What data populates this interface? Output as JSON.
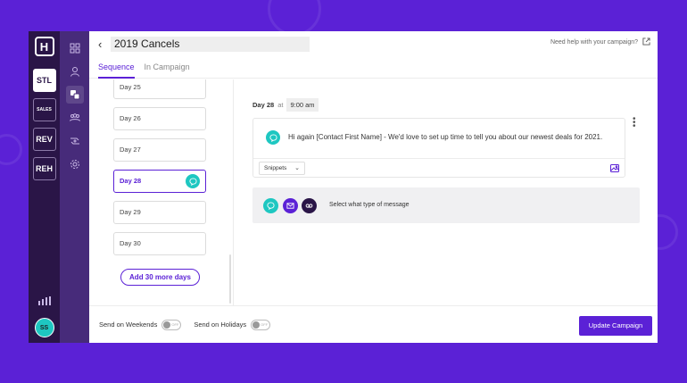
{
  "app": {
    "logo_letter": "H"
  },
  "accounts": [
    {
      "label": "STL",
      "active": true,
      "small": false
    },
    {
      "label": "SALES",
      "active": false,
      "small": true
    },
    {
      "label": "REV",
      "active": false,
      "small": false
    },
    {
      "label": "REH",
      "active": false,
      "small": false
    }
  ],
  "user": {
    "initials": "SS"
  },
  "header": {
    "back_icon": "chevron-left-icon",
    "campaign_title": "2019 Cancels",
    "help_text": "Need help with your campaign?"
  },
  "tabs": [
    {
      "label": "Sequence",
      "active": true
    },
    {
      "label": "In Campaign",
      "active": false
    }
  ],
  "days": [
    {
      "label": "Day 25",
      "active": false
    },
    {
      "label": "Day 26",
      "active": false
    },
    {
      "label": "Day 27",
      "active": false
    },
    {
      "label": "Day 28",
      "active": true
    },
    {
      "label": "Day 29",
      "active": false
    },
    {
      "label": "Day 30",
      "active": false
    }
  ],
  "add_days_button": "Add 30 more days",
  "detail": {
    "day_label": "Day 28",
    "at_text": "at",
    "time": "9:00 am",
    "message": "Hi again [Contact First Name] - We'd love to set up time to tell you about our newest deals for 2021.",
    "snippets_label": "Snippets",
    "type_prompt": "Select what type of message"
  },
  "footer": {
    "weekends_label": "Send on Weekends",
    "holidays_label": "Send on Holidays",
    "toggle_state": "OFF",
    "update_button": "Update Campaign"
  },
  "colors": {
    "brand": "#5b21d6",
    "teal": "#1ec7c1",
    "rail": "#2a1547",
    "subnav": "#472b7a"
  }
}
